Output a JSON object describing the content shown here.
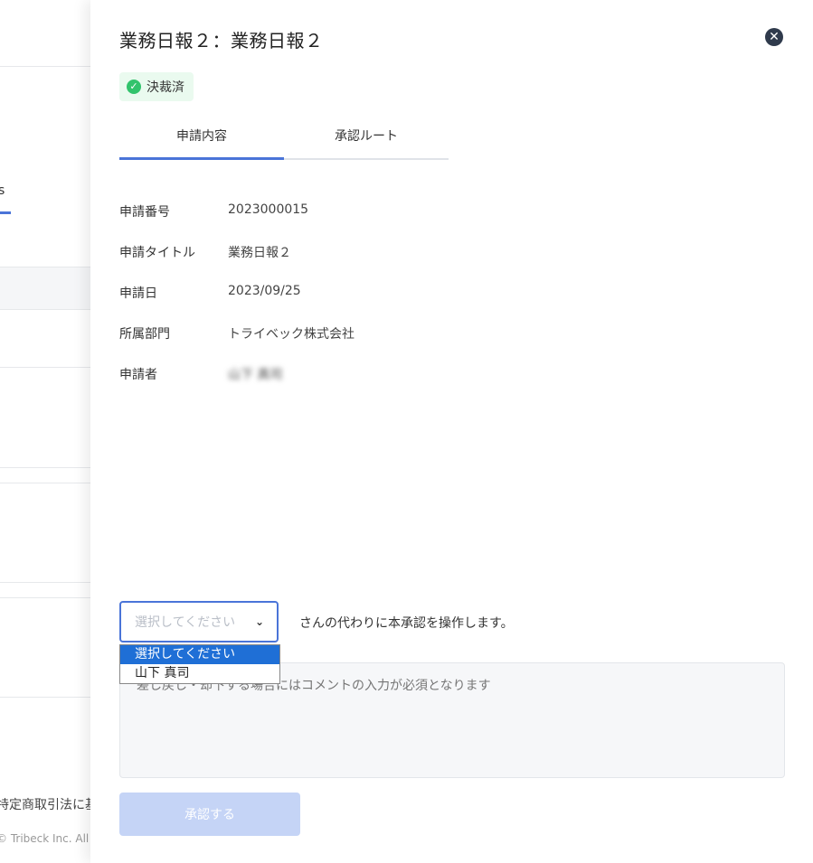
{
  "background": {
    "tab_fragment": "s",
    "footer_text": "特定商取引法に基",
    "copyright": "© Tribeck Inc. All R"
  },
  "drawer": {
    "title": "業務日報２：業務日報２",
    "close_icon": "close-icon",
    "status_badge": "決裁済",
    "tabs": [
      {
        "label": "申請内容",
        "active": true
      },
      {
        "label": "承認ルート",
        "active": false
      }
    ],
    "fields": [
      {
        "label": "申請番号",
        "value": "2023000015"
      },
      {
        "label": "申請タイトル",
        "value": "業務日報２"
      },
      {
        "label": "申請日",
        "value": "2023/09/25"
      },
      {
        "label": "所属部門",
        "value": "トライベック株式会社"
      },
      {
        "label": "申請者",
        "value": "山下 真司"
      }
    ],
    "proxy_select": {
      "placeholder": "選択してください",
      "options": [
        "選択してください",
        "山下 真司"
      ],
      "selected_index": 0
    },
    "proxy_text": "さんの代わりに本承認を操作します。",
    "comment_placeholder": "差し戻し・却下する場合にはコメントの入力が必須となります",
    "approve_label": "承認する"
  },
  "colors": {
    "accent": "#4a74d8",
    "success": "#32c36c",
    "approve_disabled": "#c5d4f6"
  }
}
